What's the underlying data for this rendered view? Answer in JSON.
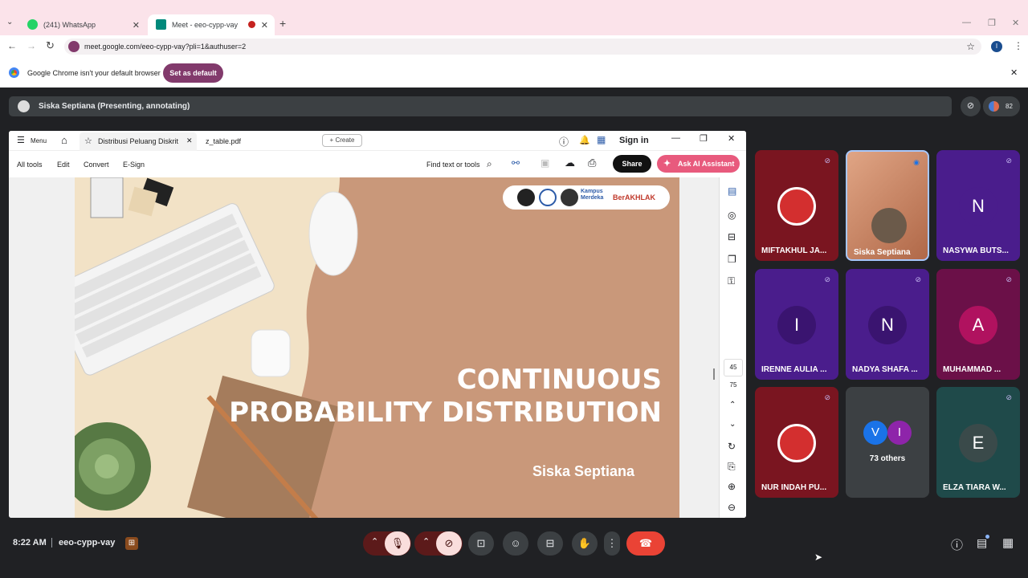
{
  "browser": {
    "tabs": [
      {
        "label": "(241) WhatsApp",
        "favicon": "whatsapp-icon"
      },
      {
        "label": "Meet - eeo-cypp-vay",
        "favicon": "meet-icon"
      }
    ],
    "url": "meet.google.com/eeo-cypp-vay?pli=1&authuser=2",
    "profile_initial": "I",
    "infobar_text": "Google Chrome isn't your default browser",
    "set_default_label": "Set as default"
  },
  "meet": {
    "presenter_label": "Siska Septiana (Presenting, annotating)",
    "participant_count": "82",
    "time": "8:22 AM",
    "meeting_code": "eeo-cypp-vay",
    "others_label": "73 others"
  },
  "pdf": {
    "menu_label": "Menu",
    "tabs": [
      "Distribusi Peluang Diskrit",
      "z_table.pdf"
    ],
    "create_label": "Create",
    "sign_in_label": "Sign in",
    "tools": [
      "All tools",
      "Edit",
      "Convert",
      "E-Sign"
    ],
    "find_label": "Find text or tools",
    "share_label": "Share",
    "ai_label": "Ask AI Assistant",
    "page_current": "45",
    "page_total": "75"
  },
  "slide": {
    "title_line1": "CONTINUOUS",
    "title_line2": "PROBABILITY DISTRIBUTION",
    "author": "Siska Septiana",
    "logo_text1": "Kampus",
    "logo_text2": "Merdeka",
    "logo_text3": "BerAKHLAK"
  },
  "participants": [
    {
      "name": "MIFTAKHUL JA...",
      "initial": "",
      "color": "#7a1520"
    },
    {
      "name": "Siska Septiana",
      "initial": "",
      "color": "#c98a6a"
    },
    {
      "name": "NASYWA BUTS...",
      "initial": "N",
      "color": "#4a1d8c"
    },
    {
      "name": "IRENNE AULIA ...",
      "initial": "I",
      "color": "#4a1d8c"
    },
    {
      "name": "NADYA SHAFA ...",
      "initial": "N",
      "color": "#4a1d8c"
    },
    {
      "name": "MUHAMMAD ...",
      "initial": "A",
      "color": "#6b1048"
    },
    {
      "name": "NUR INDAH PU...",
      "initial": "",
      "color": "#7a1520"
    },
    {
      "name": "ELZA TIARA W...",
      "initial": "E",
      "color": "#1f4a4a"
    }
  ],
  "others_avatars": [
    "V",
    "I"
  ],
  "colors": {
    "accent": "#823a6c",
    "end_call": "#ea4335",
    "ai_button": "#e85a7d"
  }
}
